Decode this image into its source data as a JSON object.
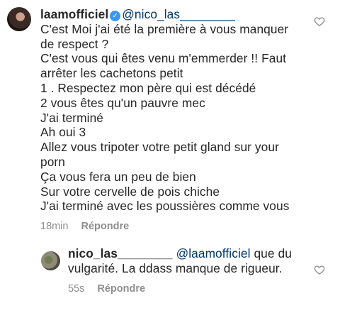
{
  "comment": {
    "username": "laamofficiel",
    "mention": "@nico_las________",
    "lines": [
      "C'est Moi j'ai été la première à vous manquer de respect ?",
      "C'est vous qui êtes venu m'emmerder !! Faut arrêter les cachetons petit",
      "1 . Respectez mon père qui est décédé",
      "2 vous êtes qu'un pauvre mec",
      "J'ai terminé",
      "Ah oui 3",
      "Allez vous tripoter votre petit gland sur your porn",
      "Ça vous fera un peu de bien",
      "Sur votre cervelle de pois chiche",
      "J'ai terminé avec les poussières comme vous"
    ],
    "time": "18min",
    "reply_label": "Répondre",
    "like_icon": "heart-outline-icon",
    "verified_icon": "verified-badge-icon",
    "verified_color": "#3897f0"
  },
  "reply": {
    "username": "nico_las________",
    "mention": "@laamofficiel",
    "text": " que du vulgarité. La ddass manque de rigueur.",
    "time": "55s",
    "reply_label": "Répondre",
    "like_icon": "heart-outline-icon"
  },
  "colors": {
    "text": "#262626",
    "muted": "#8e8e8e",
    "mention": "#003569"
  }
}
